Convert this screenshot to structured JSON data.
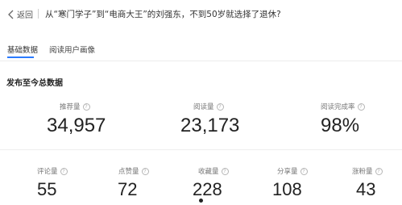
{
  "header": {
    "back_label": "返回",
    "article_title": "从“寒门学子”到“电商大王”的刘强东，不到50岁就选择了退休?"
  },
  "tabs": [
    {
      "label": "基础数据",
      "active": true
    },
    {
      "label": "阅读用户画像",
      "active": false
    }
  ],
  "section_title": "发布至今总数据",
  "primary_metrics": [
    {
      "label": "推荐量",
      "value": "34,957"
    },
    {
      "label": "阅读量",
      "value": "23,173"
    },
    {
      "label": "阅读完成率",
      "value": "98%"
    }
  ],
  "secondary_metrics": [
    {
      "label": "评论量",
      "value": "55"
    },
    {
      "label": "点赞量",
      "value": "72"
    },
    {
      "label": "收藏量",
      "value": "228"
    },
    {
      "label": "分享量",
      "value": "108"
    },
    {
      "label": "涨粉量",
      "value": "43"
    }
  ],
  "help_glyph": "?",
  "accent_color": "#2a7bff"
}
